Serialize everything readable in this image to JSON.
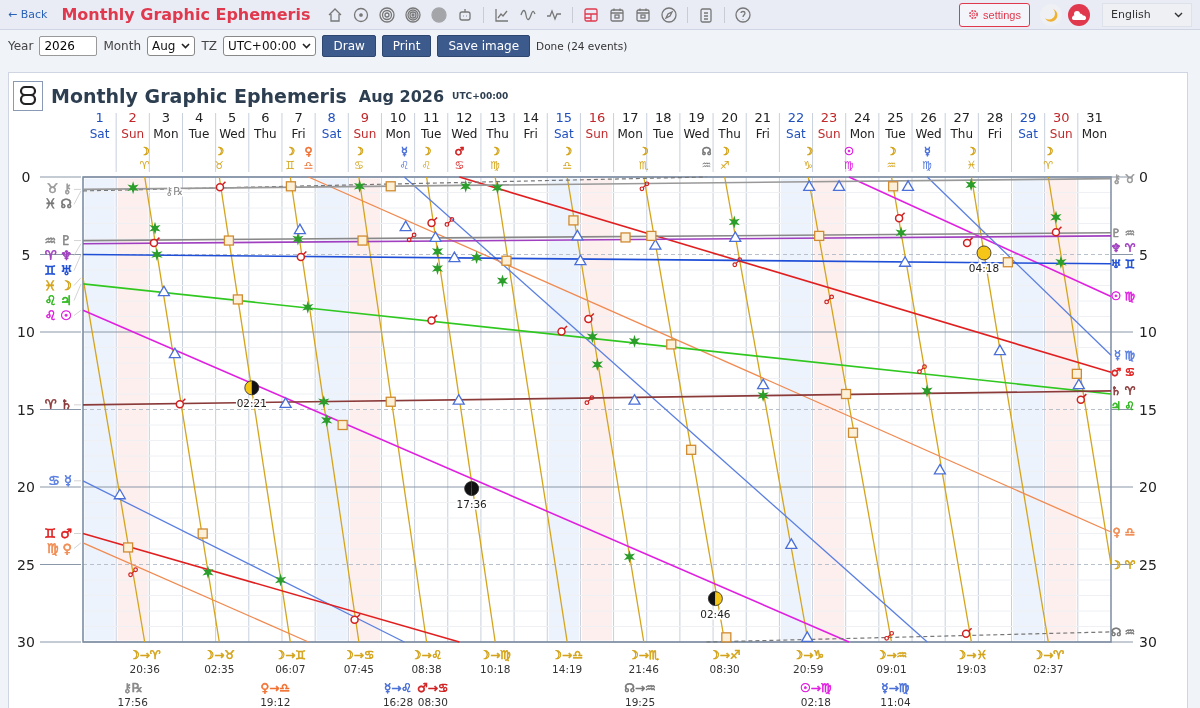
{
  "topbar": {
    "back": "← Back",
    "title": "Monthly Graphic Ephemeris",
    "toolbar": [
      [
        {
          "selected": false
        },
        {
          "selected": false
        },
        {
          "selected": false
        },
        {
          "selected": false
        },
        {
          "selected": false
        },
        {
          "selected": false
        }
      ],
      [
        {
          "selected": false
        },
        {
          "selected": false
        },
        {
          "selected": false
        }
      ],
      [
        {
          "selected": true
        },
        {
          "selected": false
        },
        {
          "selected": false
        },
        {
          "selected": false
        }
      ],
      [
        {
          "selected": false
        }
      ],
      [
        {
          "selected": false
        }
      ]
    ],
    "settings": "settings",
    "language": "English"
  },
  "controls": {
    "year_label": "Year",
    "year": "2026",
    "month_label": "Month",
    "month": "Aug",
    "tz_label": "TZ",
    "tz": "UTC+00:00",
    "buttons": [
      "Draw",
      "Print",
      "Save image"
    ],
    "status": "Done (24 events)"
  },
  "chart": {
    "title": "Monthly Graphic Ephemeris",
    "period": "Aug 2026",
    "timezone": "UTC+00:00",
    "days": [
      {
        "date": "1",
        "weekday": "Sat",
        "kind": "sat"
      },
      {
        "date": "2",
        "weekday": "Sun",
        "kind": "sun"
      },
      {
        "date": "3",
        "weekday": "Mon",
        "kind": "weekday"
      },
      {
        "date": "4",
        "weekday": "Tue",
        "kind": "weekday"
      },
      {
        "date": "5",
        "weekday": "Wed",
        "kind": "weekday"
      },
      {
        "date": "6",
        "weekday": "Thu",
        "kind": "weekday"
      },
      {
        "date": "7",
        "weekday": "Fri",
        "kind": "weekday"
      },
      {
        "date": "8",
        "weekday": "Sat",
        "kind": "sat"
      },
      {
        "date": "9",
        "weekday": "Sun",
        "kind": "sun"
      },
      {
        "date": "10",
        "weekday": "Mon",
        "kind": "weekday"
      },
      {
        "date": "11",
        "weekday": "Tue",
        "kind": "weekday"
      },
      {
        "date": "12",
        "weekday": "Wed",
        "kind": "weekday"
      },
      {
        "date": "13",
        "weekday": "Thu",
        "kind": "weekday"
      },
      {
        "date": "14",
        "weekday": "Fri",
        "kind": "weekday"
      },
      {
        "date": "15",
        "weekday": "Sat",
        "kind": "sat"
      },
      {
        "date": "16",
        "weekday": "Sun",
        "kind": "sun"
      },
      {
        "date": "17",
        "weekday": "Mon",
        "kind": "weekday"
      },
      {
        "date": "18",
        "weekday": "Tue",
        "kind": "weekday"
      },
      {
        "date": "19",
        "weekday": "Wed",
        "kind": "weekday"
      },
      {
        "date": "20",
        "weekday": "Thu",
        "kind": "weekday"
      },
      {
        "date": "21",
        "weekday": "Fri",
        "kind": "weekday"
      },
      {
        "date": "22",
        "weekday": "Sat",
        "kind": "sat"
      },
      {
        "date": "23",
        "weekday": "Sun",
        "kind": "sun"
      },
      {
        "date": "24",
        "weekday": "Mon",
        "kind": "weekday"
      },
      {
        "date": "25",
        "weekday": "Tue",
        "kind": "weekday"
      },
      {
        "date": "26",
        "weekday": "Wed",
        "kind": "weekday"
      },
      {
        "date": "27",
        "weekday": "Thu",
        "kind": "weekday"
      },
      {
        "date": "28",
        "weekday": "Fri",
        "kind": "weekday"
      },
      {
        "date": "29",
        "weekday": "Sat",
        "kind": "sat"
      },
      {
        "date": "30",
        "weekday": "Sun",
        "kind": "sun"
      },
      {
        "date": "31",
        "weekday": "Mon",
        "kind": "weekday"
      }
    ],
    "left_ticks": [
      "0",
      "5",
      "10",
      "15",
      "20",
      "25",
      "30"
    ],
    "right_ticks": [
      "0",
      "5",
      "10",
      "15",
      "20",
      "25",
      "30"
    ],
    "left_labels": [
      {
        "text": "♉ ⚷",
        "color": "#999999"
      },
      {
        "text": "♓ ☊",
        "color": "#777777"
      },
      {
        "text": "♒ ♇",
        "color": "#888888"
      },
      {
        "text": "♈ ♆",
        "color": "#a040c0"
      },
      {
        "text": "♊ ♅",
        "color": "#1f4fd6"
      },
      {
        "text": "♓ ☽",
        "color": "#d4a41c"
      },
      {
        "text": "♌ ♃",
        "color": "#30b820"
      },
      {
        "text": "♌ ☉",
        "color": "#e020e0"
      },
      {
        "text": "♈ ♄",
        "color": "#8b3a3a"
      },
      {
        "text": "♋ ☿",
        "color": "#5a7fe0"
      },
      {
        "text": "♊ ♂",
        "color": "#e02020"
      },
      {
        "text": "♍ ♀",
        "color": "#f08a50"
      }
    ],
    "right_labels": [
      {
        "text": "⚷ ♉",
        "color": "#999999"
      },
      {
        "text": "♇ ♒",
        "color": "#888888"
      },
      {
        "text": "♆ ♈",
        "color": "#a040c0"
      },
      {
        "text": "♅ ♊",
        "color": "#1f4fd6"
      },
      {
        "text": "☉ ♍",
        "color": "#e020e0"
      },
      {
        "text": "☿ ♍",
        "color": "#5a7fe0"
      },
      {
        "text": "♂ ♋",
        "color": "#e02020"
      },
      {
        "text": "♄ ♈",
        "color": "#8b3a3a"
      },
      {
        "text": "♃ ♌",
        "color": "#30b820"
      },
      {
        "text": "♀ ♎",
        "color": "#f08a50"
      },
      {
        "text": "☽ ♈",
        "color": "#d4a41c"
      },
      {
        "text": "☊ ♒",
        "color": "#777777"
      }
    ],
    "station_label": "⚷℞",
    "phase_times": [
      "02:21",
      "17:36",
      "02:46",
      "04:18"
    ],
    "top_markers": [
      {
        "planet": "☽",
        "sign": "♈",
        "color": "#d4a41c"
      },
      {
        "planet": "☽",
        "sign": "♉",
        "color": "#d4a41c"
      },
      {
        "planet": "☽",
        "sign": "♊",
        "color": "#d4a41c"
      },
      {
        "planet": "♀",
        "sign": "♎",
        "color": "#f07030"
      },
      {
        "planet": "☽",
        "sign": "♋",
        "color": "#d4a41c"
      },
      {
        "planet": "☿",
        "sign": "♌",
        "color": "#4a70d8"
      },
      {
        "planet": "☽",
        "sign": "♌",
        "color": "#d4a41c"
      },
      {
        "planet": "♂",
        "sign": "♋",
        "color": "#d02020"
      },
      {
        "planet": "☽",
        "sign": "♍",
        "color": "#d4a41c"
      },
      {
        "planet": "☽",
        "sign": "♎",
        "color": "#d4a41c"
      },
      {
        "planet": "☽",
        "sign": "♏",
        "color": "#d4a41c"
      },
      {
        "planet": "☊",
        "sign": "♒",
        "color": "#777777"
      },
      {
        "planet": "☽",
        "sign": "♐",
        "color": "#d4a41c"
      },
      {
        "planet": "☽",
        "sign": "♑",
        "color": "#d4a41c"
      },
      {
        "planet": "☉",
        "sign": "♍",
        "color": "#e020e0"
      },
      {
        "planet": "☽",
        "sign": "♒",
        "color": "#d4a41c"
      },
      {
        "planet": "☿",
        "sign": "♍",
        "color": "#4a70d8"
      },
      {
        "planet": "☽",
        "sign": "♓",
        "color": "#d4a41c"
      },
      {
        "planet": "☽",
        "sign": "♈",
        "color": "#d4a41c"
      }
    ],
    "events": [
      [
        {
          "glyph": "☽→♈",
          "time": "20:36",
          "color": "#d4a41c"
        },
        {
          "glyph": "☽→♉",
          "time": "02:35",
          "color": "#d4a41c"
        },
        {
          "glyph": "☽→♊",
          "time": "06:07",
          "color": "#d4a41c"
        },
        {
          "glyph": "☽→♋",
          "time": "07:45",
          "color": "#d4a41c"
        },
        {
          "glyph": "☽→♌",
          "time": "08:38",
          "color": "#d4a41c"
        },
        {
          "glyph": "☽→♍",
          "time": "10:18",
          "color": "#d4a41c"
        },
        {
          "glyph": "☽→♎",
          "time": "14:19",
          "color": "#d4a41c"
        },
        {
          "glyph": "☽→♏",
          "time": "21:46",
          "color": "#d4a41c"
        },
        {
          "glyph": "☽→♐",
          "time": "08:30",
          "color": "#d4a41c"
        },
        {
          "glyph": "☽→♑",
          "time": "20:59",
          "color": "#d4a41c"
        },
        {
          "glyph": "☽→♒",
          "time": "09:01",
          "color": "#d4a41c"
        },
        {
          "glyph": "☽→♓",
          "time": "19:03",
          "color": "#d4a41c"
        },
        {
          "glyph": "☽→♈",
          "time": "02:37",
          "color": "#d4a41c"
        }
      ],
      [
        {
          "glyph": "⚷℞",
          "time": "17:56",
          "color": "#888888"
        },
        {
          "glyph": "♀→♎",
          "time": "19:12",
          "color": "#f07030"
        },
        {
          "glyph": "☿→♌",
          "time": "16:28",
          "color": "#4a70d8"
        },
        {
          "glyph": "♂→♋",
          "time": "08:30",
          "color": "#d02020"
        },
        {
          "glyph": "☊→♒",
          "time": "19:25",
          "color": "#777777"
        },
        {
          "glyph": "☉→♍",
          "time": "02:18",
          "color": "#e020e0"
        },
        {
          "glyph": "☿→♍",
          "time": "11:04",
          "color": "#4a70d8"
        }
      ]
    ]
  }
}
